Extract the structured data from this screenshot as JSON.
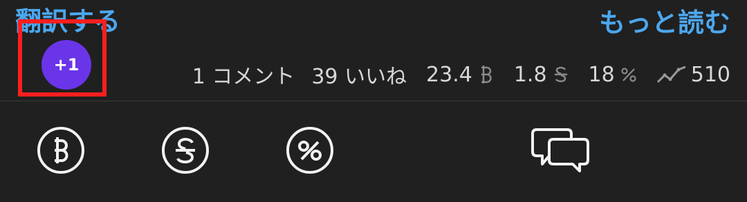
{
  "links": {
    "translate": "翻訳する",
    "read_more": "もっと読む"
  },
  "badge": {
    "label": "+1",
    "color": "#6a35e8",
    "highlight_color": "#ff1f1f"
  },
  "stats": {
    "comments": "1 コメント",
    "likes": "39 いいね",
    "baht_value": "23.4",
    "vote_value": "1.8",
    "percent_value": "18",
    "views": "510",
    "icons": [
      "baht-icon",
      "strike-s-icon",
      "percent-icon",
      "trend-icon"
    ]
  },
  "actions": [
    {
      "name": "baht",
      "icon": "baht-circle-icon"
    },
    {
      "name": "vote",
      "icon": "strike-s-circle-icon"
    },
    {
      "name": "percent",
      "icon": "percent-circle-icon"
    },
    {
      "name": "comment",
      "icon": "chat-bubbles-icon"
    }
  ],
  "colors": {
    "background": "#202020",
    "link": "#4ca7ee",
    "text": "#d7d7d7"
  }
}
